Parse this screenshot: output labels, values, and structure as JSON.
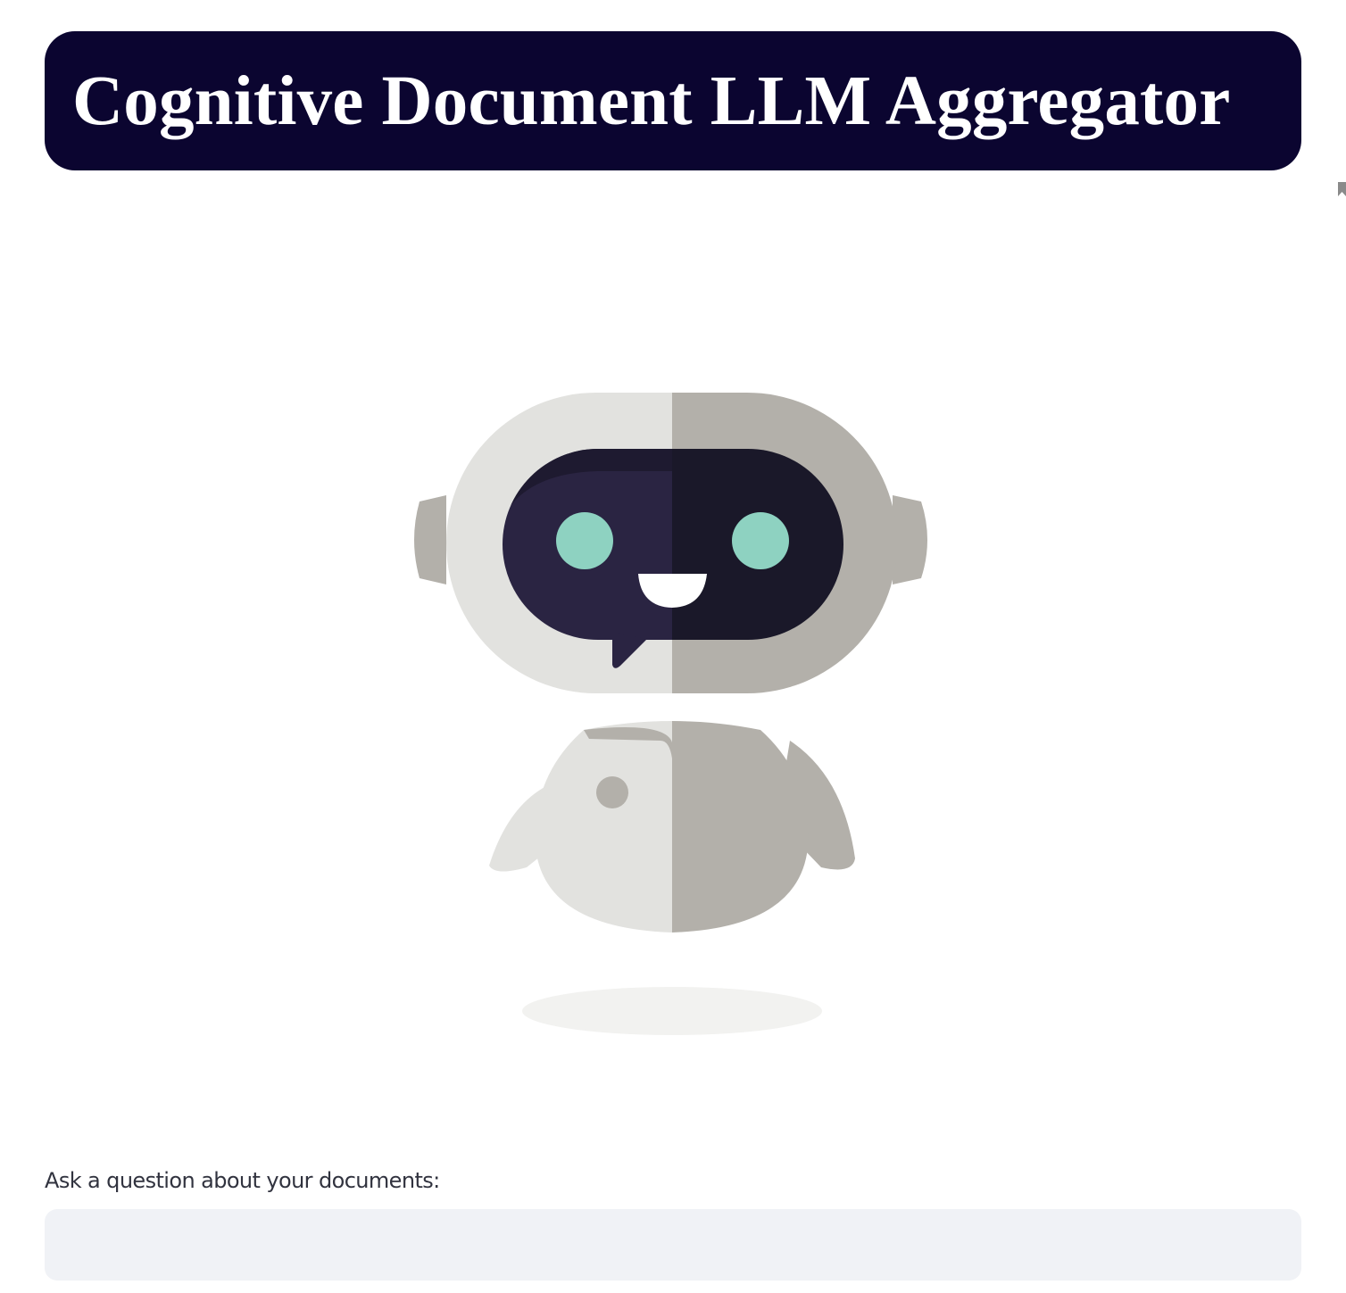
{
  "header": {
    "title": "Cognitive Document LLM Aggregator",
    "background_color": "#0b0530",
    "text_color": "#ffffff"
  },
  "hero": {
    "image": "robot-mascot-illustration",
    "colors": {
      "light_shell": "#e2e2df",
      "dark_shell": "#b3b0aa",
      "visor_left": "#2a2442",
      "visor_right": "#1a1829",
      "eyes": "#8ed2c1",
      "mouth": "#ffffff"
    }
  },
  "question": {
    "label": "Ask a question about your documents:",
    "value": "",
    "placeholder": "",
    "input_background": "#f0f2f6"
  },
  "misc": {
    "corner_icon": "bookmark-icon"
  }
}
